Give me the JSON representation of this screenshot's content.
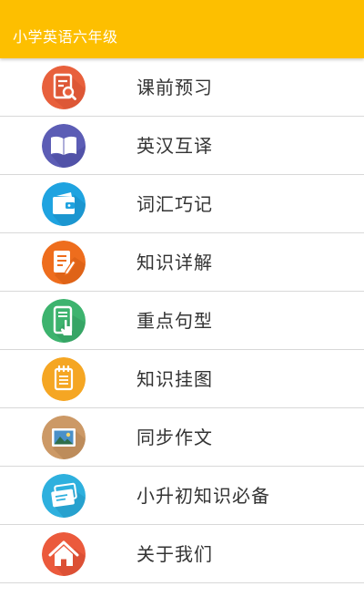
{
  "app_bar": {
    "title": "小学英语六年级",
    "color": "#FDBF00"
  },
  "menu": {
    "items": [
      {
        "label": "课前预习",
        "icon": "document-search-icon",
        "color": "#E8603C"
      },
      {
        "label": "英汉互译",
        "icon": "book-icon",
        "color": "#5C5DB5"
      },
      {
        "label": "词汇巧记",
        "icon": "wallet-icon",
        "color": "#1FA3E0"
      },
      {
        "label": "知识详解",
        "icon": "note-pencil-icon",
        "color": "#EE6D1D"
      },
      {
        "label": "重点句型",
        "icon": "tablet-touch-icon",
        "color": "#3DB36E"
      },
      {
        "label": "知识挂图",
        "icon": "notepad-icon",
        "color": "#F5A623"
      },
      {
        "label": "同步作文",
        "icon": "picture-icon",
        "color": "#CC9966"
      },
      {
        "label": "小升初知识必备",
        "icon": "cards-icon",
        "color": "#2EB0DE"
      },
      {
        "label": "关于我们",
        "icon": "home-icon",
        "color": "#EB5A3C"
      }
    ]
  }
}
